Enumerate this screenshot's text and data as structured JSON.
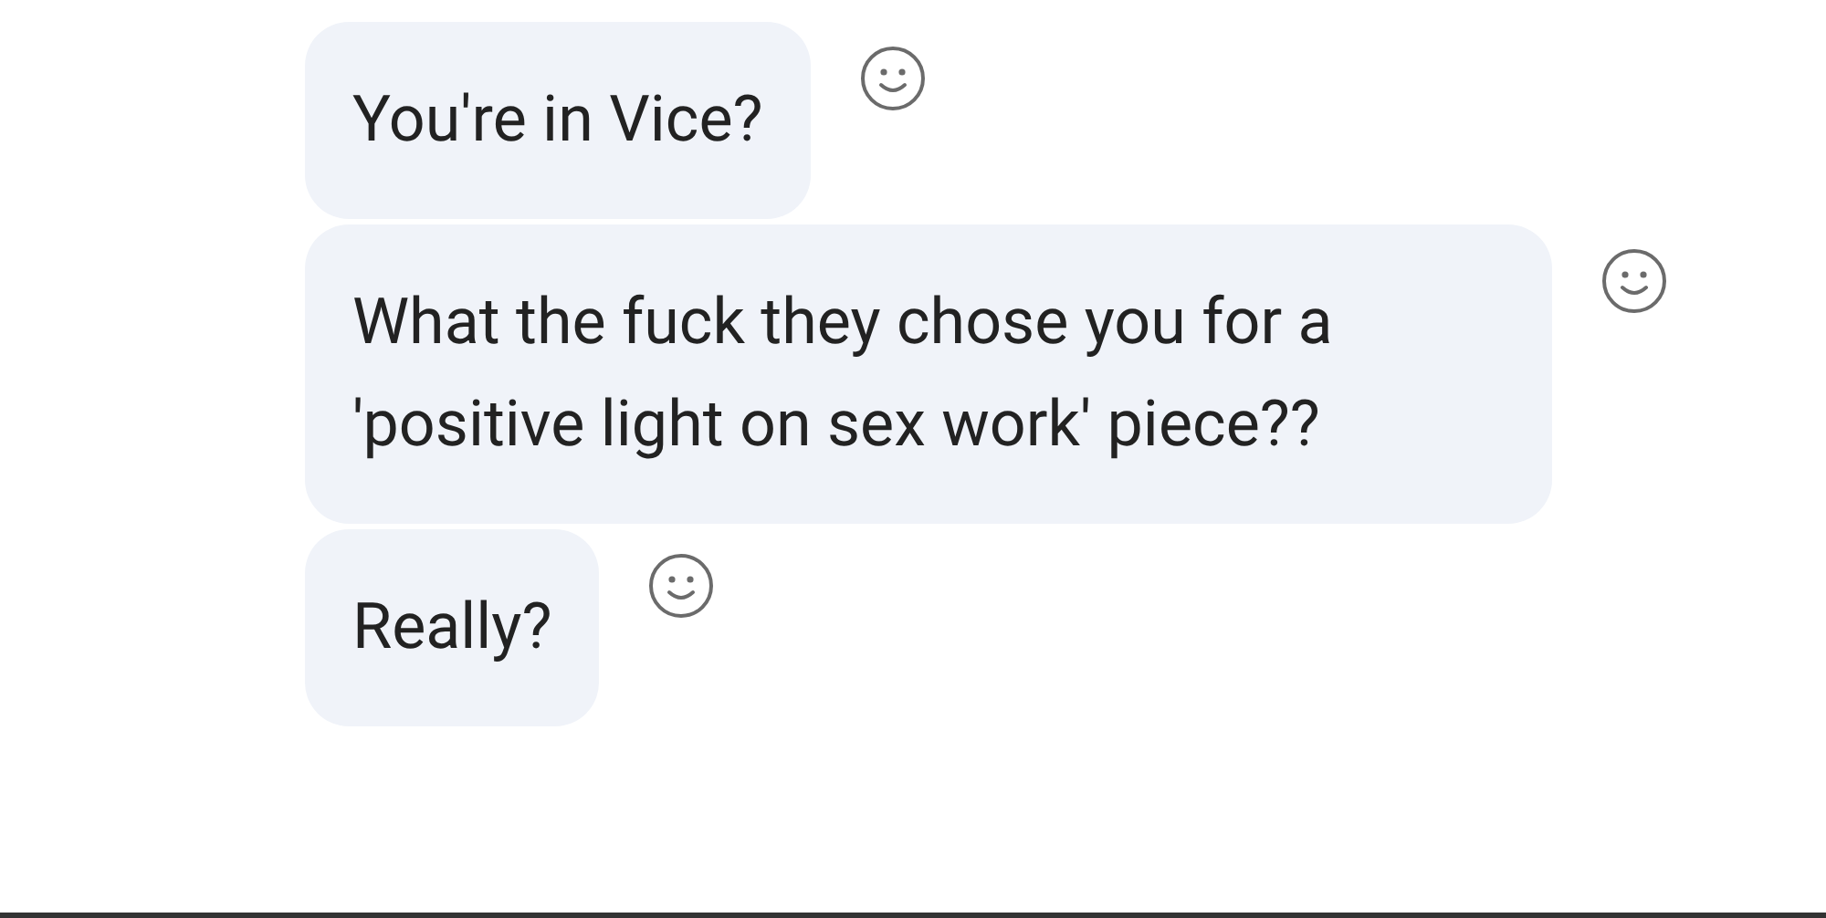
{
  "messages": [
    {
      "text": "You're in Vice?"
    },
    {
      "text": "What the fuck they chose you for a 'positive light on sex work' piece??"
    },
    {
      "text": "Really?"
    }
  ]
}
